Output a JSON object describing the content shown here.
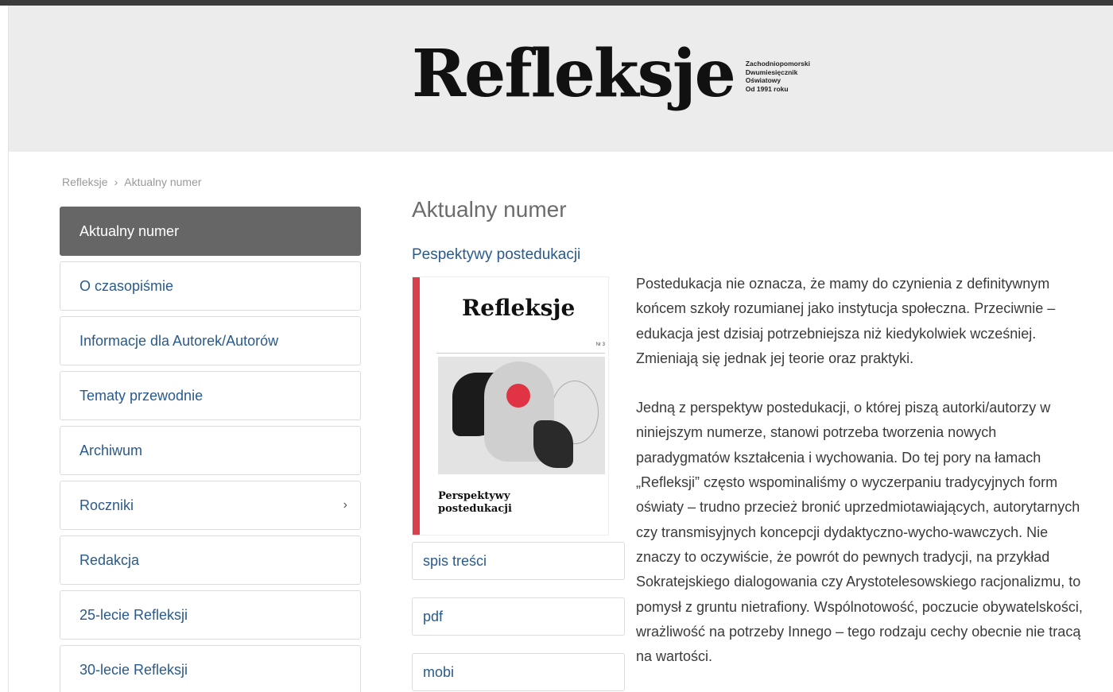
{
  "header": {
    "logo": "Refleksje",
    "logo_sub": [
      "Zachodniopomorski",
      "Dwumiesięcznik",
      "Oświatowy",
      "Od 1991 roku"
    ]
  },
  "breadcrumb": {
    "home": "Refleksje",
    "separator": "›",
    "current": "Aktualny numer"
  },
  "sidebar": {
    "items": [
      {
        "label": "Aktualny numer",
        "active": true
      },
      {
        "label": "O czasopiśmie"
      },
      {
        "label": "Informacje dla Autorek/Autorów"
      },
      {
        "label": "Tematy przewodnie"
      },
      {
        "label": "Archiwum"
      },
      {
        "label": "Roczniki",
        "chevron": "›"
      },
      {
        "label": "Redakcja"
      },
      {
        "label": "25-lecie Refleksji"
      },
      {
        "label": "30-lecie Refleksji"
      }
    ]
  },
  "main": {
    "title": "Aktualny numer",
    "issue_link": "Pespektywy postedukacji",
    "cover": {
      "title": "Refleksje",
      "number": "Nr 3",
      "subtitle_line1": "Perspektywy",
      "subtitle_line2": "postedukacji"
    },
    "buttons": {
      "toc": "spis treści",
      "pdf": "pdf",
      "mobi": "mobi"
    },
    "description": [
      "Postedukacja nie oznacza, że mamy do czynienia z definitywnym końcem szkoły rozumianej jako instytucja społeczna. Przeciwnie – edukacja jest dzisiaj potrzebniejsza niż kiedykolwiek wcześniej. Zmieniają się jednak jej teorie oraz praktyki.",
      "Jedną z perspektyw postedukacji, o której piszą autorki/autorzy w niniejszym numerze, stanowi potrzeba tworzenia nowych paradygmatów kształcenia i wychowania. Do tej pory na łamach „Refleksji” często wspominaliśmy o wyczerpaniu tradycyjnych form oświaty – trudno przecież bronić uprzedmiotawiających, autorytarnych czy transmisyjnych koncepcji dydaktyczno-wycho-wawczych. Nie znaczy to oczywiście, że powrót do pewnych tradycji, na przykład Sokratejskiego dialogowania czy Arystotelesowskiego racjonalizmu, to pomysł z gruntu nietrafiony. Wspólnotowość, poczucie obywatelskości, wrażliwość na potrzeby Innego – tego rodzaju cechy obecnie nie tracą na wartości."
    ]
  }
}
